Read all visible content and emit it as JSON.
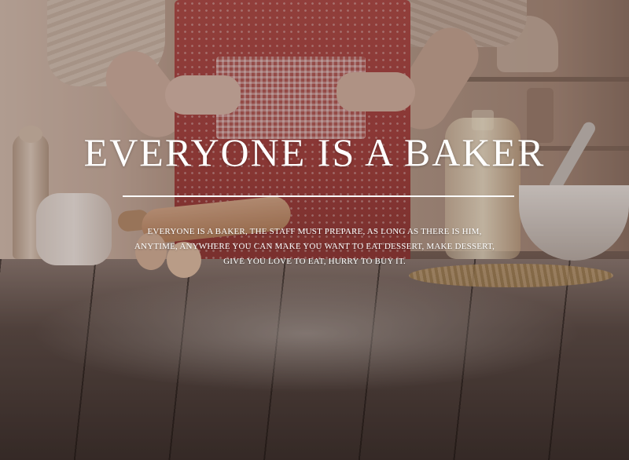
{
  "hero": {
    "title": "EVERYONE IS A BAKER",
    "description": "EVERYONE IS A BAKER, THE STAFF MUST PREPARE, AS LONG AS THERE IS HIM, ANYTIME, ANYWHERE YOU CAN MAKE YOU WANT TO EAT DESSERT, MAKE DESSERT, GIVE YOU LOVE TO EAT, HURRY TO BUY IT."
  },
  "colors": {
    "text": "#ffffff",
    "divider": "#ffffff",
    "apron": "#a5403e",
    "table": "#5b4c47"
  }
}
